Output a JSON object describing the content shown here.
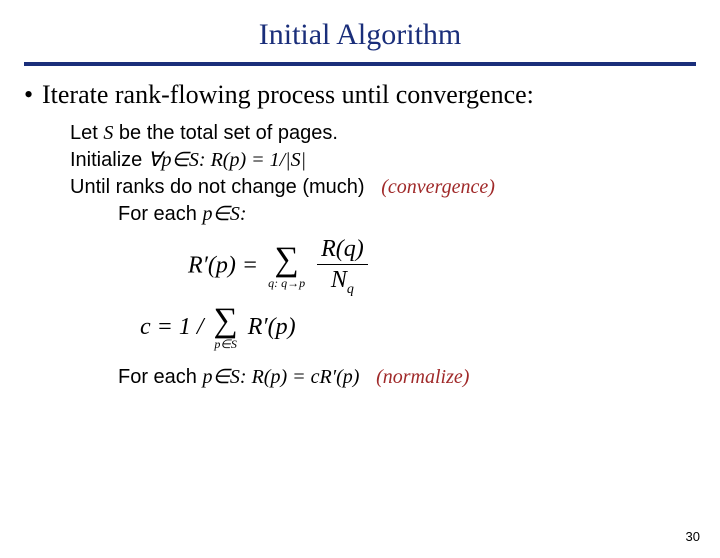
{
  "title": "Initial Algorithm",
  "bullet": "Iterate rank-flowing process until convergence:",
  "algo": {
    "line1_a": "Let ",
    "line1_S": "S",
    "line1_b": " be the total set of pages.",
    "line2_a": "Initialize ",
    "line2_sym": "∀p∈S: R(p) = ",
    "line2_rhs": "1/|S|",
    "line3_a": "Until ranks do not change (much)",
    "line3_comment": "(convergence)",
    "line4_a": "For each ",
    "line4_sym": "p∈S:",
    "formula1_lhs": "R′(p) =",
    "formula1_sub": "q: q→p",
    "formula1_num": "R(q)",
    "formula1_den_N": "N",
    "formula1_den_q": "q",
    "formula2_lhs": "c = 1 /",
    "formula2_sub": "p∈S",
    "formula2_body": "R′(p)",
    "line5_a": "For each ",
    "line5_sym": "p∈S: R(p) = cR′(p)",
    "line5_comment": "(normalize)"
  },
  "slideNumber": "30"
}
